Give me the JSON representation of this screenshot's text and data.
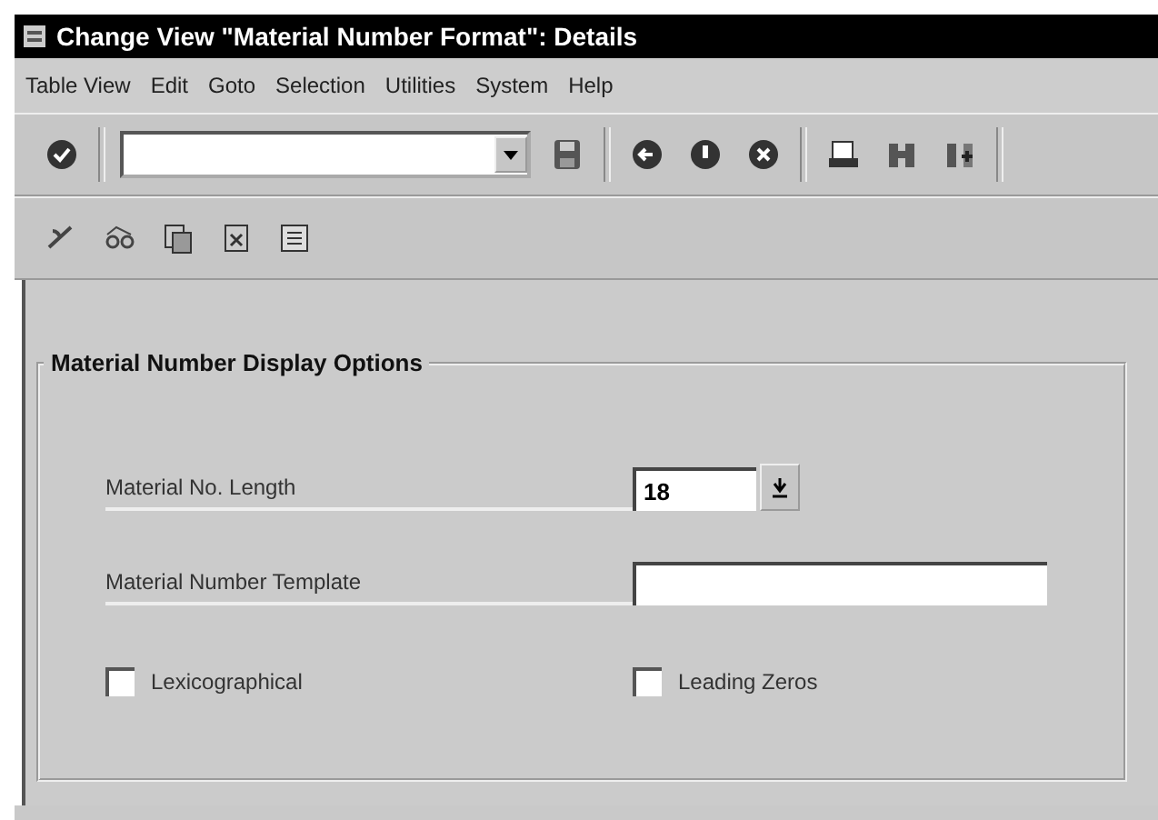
{
  "window": {
    "title": "Change View \"Material Number Format\": Details"
  },
  "menu": [
    "Table View",
    "Edit",
    "Goto",
    "Selection",
    "Utilities",
    "System",
    "Help"
  ],
  "group": {
    "title": "Material Number Display Options",
    "fields": [
      {
        "kind": "dropdown",
        "label": "Material No. Length",
        "value": "18"
      },
      {
        "kind": "text",
        "label": "Material Number Template"
      }
    ],
    "checkboxes": [
      {
        "label": "Lexicographical",
        "checked": false
      },
      {
        "label": "Leading Zeros",
        "checked": false
      }
    ]
  }
}
